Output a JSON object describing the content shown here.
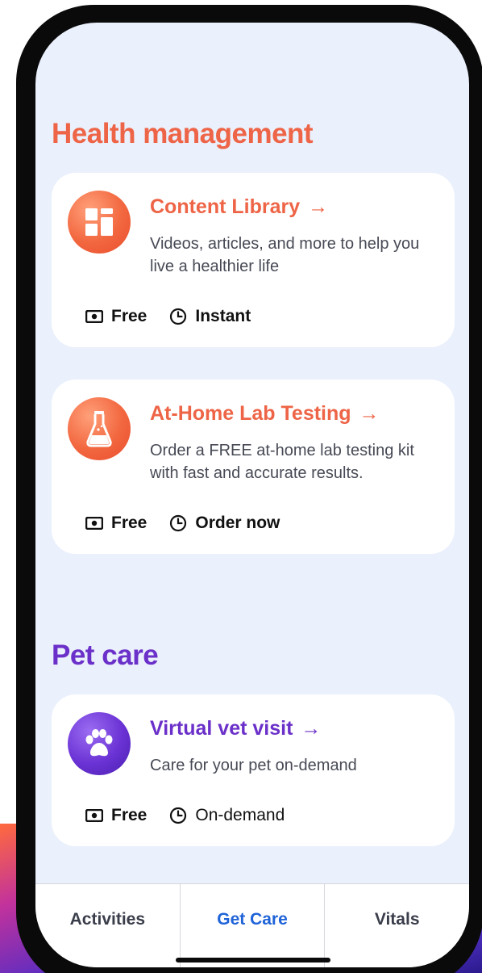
{
  "colors": {
    "health_accent": "#ee6446",
    "pet_accent": "#6b30c9",
    "active_tab": "#1f63d8",
    "screen_bg": "#eaf0fc"
  },
  "health": {
    "title": "Health management",
    "cards": [
      {
        "title": "Content Library",
        "arrow": "→",
        "icon": "grid-layout-icon",
        "description": "Videos, articles, and more to help you live a healthier life",
        "price": "Free",
        "timing": "Instant"
      },
      {
        "title": "At-Home Lab Testing",
        "arrow": "→",
        "icon": "flask-icon",
        "description": "Order a FREE at-home lab testing kit with fast and accurate results.",
        "price": "Free",
        "timing": "Order now"
      }
    ]
  },
  "pet": {
    "title": "Pet care",
    "cards": [
      {
        "title": "Virtual vet visit",
        "arrow": "→",
        "icon": "paw-icon",
        "description": "Care for your pet on-demand",
        "price": "Free",
        "timing": "On-demand"
      }
    ]
  },
  "tabs": [
    {
      "label": "Activities",
      "active": false
    },
    {
      "label": "Get Care",
      "active": true
    },
    {
      "label": "Vitals",
      "active": false
    }
  ]
}
